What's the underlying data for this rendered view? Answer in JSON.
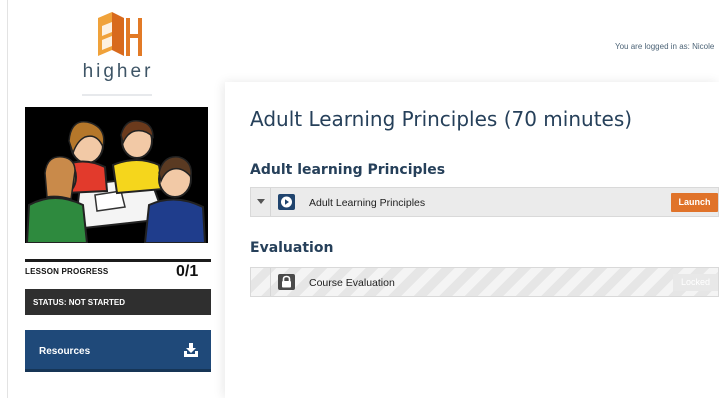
{
  "brand": {
    "name": "higher",
    "colors": {
      "orange": "#e27a26",
      "navy": "#1f4979",
      "launch": "#e0732a"
    }
  },
  "header": {
    "login_note": "You are logged in as: Nicole"
  },
  "sidebar": {
    "hero_image": "people-collaborating-illustration",
    "progress": {
      "label": "LESSON PROGRESS",
      "count": "0/1",
      "completed": 0,
      "total": 1
    },
    "status": "STATUS: NOT STARTED",
    "resources": {
      "label": "Resources",
      "icon": "download-icon"
    }
  },
  "main": {
    "title": "Adult Learning Principles (70 minutes)",
    "sections": [
      {
        "heading": "Adult learning Principles",
        "item": {
          "label": "Adult Learning Principles",
          "icon": "play-icon",
          "action": "Launch",
          "expanded_indicator": "caret-down-icon"
        }
      },
      {
        "heading": "Evaluation",
        "item": {
          "label": "Course Evaluation",
          "icon": "lock-icon",
          "action": "Locked"
        }
      }
    ]
  }
}
